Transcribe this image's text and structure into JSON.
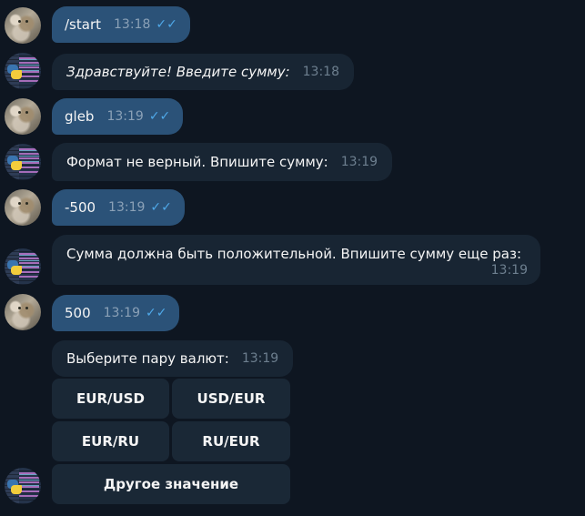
{
  "messages": [
    {
      "direction": "out",
      "text": "/start",
      "time": "13:18",
      "status": "read"
    },
    {
      "direction": "in",
      "text": "Здравствуйте! Введите сумму:",
      "time": "13:18",
      "style": "italic"
    },
    {
      "direction": "out",
      "text": "gleb",
      "time": "13:19",
      "status": "read"
    },
    {
      "direction": "in",
      "text": "Формат не верный. Впишите сумму:",
      "time": "13:19"
    },
    {
      "direction": "out",
      "text": "-500",
      "time": "13:19",
      "status": "read"
    },
    {
      "direction": "in",
      "text": "Сумма должна быть положительной. Впишите сумму еще раз:",
      "time": "13:19"
    },
    {
      "direction": "out",
      "text": "500",
      "time": "13:19",
      "status": "read"
    },
    {
      "direction": "in",
      "text": "Выберите пару валют:",
      "time": "13:19"
    }
  ],
  "keyboard": {
    "buttons": [
      "EUR/USD",
      "USD/EUR",
      "EUR/RU",
      "RU/EUR",
      "Другое значение"
    ]
  },
  "icons": {
    "read_receipt": "double-check-icon",
    "user_avatar": "cat-photo-avatar",
    "bot_avatar": "python-code-avatar"
  },
  "colors": {
    "background": "#0e1621",
    "outgoing_bubble": "#2b5278",
    "incoming_bubble": "#182533",
    "keyboard_button": "#1a2836",
    "read_ticks": "#4fa8e8"
  }
}
